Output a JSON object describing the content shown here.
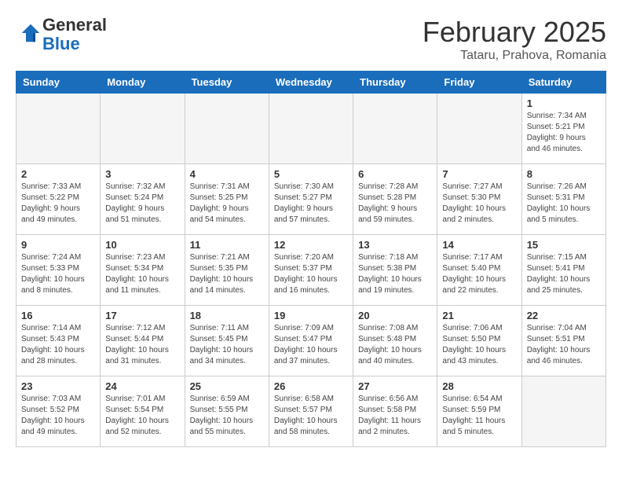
{
  "header": {
    "logo_general": "General",
    "logo_blue": "Blue",
    "month": "February 2025",
    "location": "Tataru, Prahova, Romania"
  },
  "days_of_week": [
    "Sunday",
    "Monday",
    "Tuesday",
    "Wednesday",
    "Thursday",
    "Friday",
    "Saturday"
  ],
  "weeks": [
    [
      {
        "day": "",
        "info": ""
      },
      {
        "day": "",
        "info": ""
      },
      {
        "day": "",
        "info": ""
      },
      {
        "day": "",
        "info": ""
      },
      {
        "day": "",
        "info": ""
      },
      {
        "day": "",
        "info": ""
      },
      {
        "day": "1",
        "info": "Sunrise: 7:34 AM\nSunset: 5:21 PM\nDaylight: 9 hours and 46 minutes."
      }
    ],
    [
      {
        "day": "2",
        "info": "Sunrise: 7:33 AM\nSunset: 5:22 PM\nDaylight: 9 hours and 49 minutes."
      },
      {
        "day": "3",
        "info": "Sunrise: 7:32 AM\nSunset: 5:24 PM\nDaylight: 9 hours and 51 minutes."
      },
      {
        "day": "4",
        "info": "Sunrise: 7:31 AM\nSunset: 5:25 PM\nDaylight: 9 hours and 54 minutes."
      },
      {
        "day": "5",
        "info": "Sunrise: 7:30 AM\nSunset: 5:27 PM\nDaylight: 9 hours and 57 minutes."
      },
      {
        "day": "6",
        "info": "Sunrise: 7:28 AM\nSunset: 5:28 PM\nDaylight: 9 hours and 59 minutes."
      },
      {
        "day": "7",
        "info": "Sunrise: 7:27 AM\nSunset: 5:30 PM\nDaylight: 10 hours and 2 minutes."
      },
      {
        "day": "8",
        "info": "Sunrise: 7:26 AM\nSunset: 5:31 PM\nDaylight: 10 hours and 5 minutes."
      }
    ],
    [
      {
        "day": "9",
        "info": "Sunrise: 7:24 AM\nSunset: 5:33 PM\nDaylight: 10 hours and 8 minutes."
      },
      {
        "day": "10",
        "info": "Sunrise: 7:23 AM\nSunset: 5:34 PM\nDaylight: 10 hours and 11 minutes."
      },
      {
        "day": "11",
        "info": "Sunrise: 7:21 AM\nSunset: 5:35 PM\nDaylight: 10 hours and 14 minutes."
      },
      {
        "day": "12",
        "info": "Sunrise: 7:20 AM\nSunset: 5:37 PM\nDaylight: 10 hours and 16 minutes."
      },
      {
        "day": "13",
        "info": "Sunrise: 7:18 AM\nSunset: 5:38 PM\nDaylight: 10 hours and 19 minutes."
      },
      {
        "day": "14",
        "info": "Sunrise: 7:17 AM\nSunset: 5:40 PM\nDaylight: 10 hours and 22 minutes."
      },
      {
        "day": "15",
        "info": "Sunrise: 7:15 AM\nSunset: 5:41 PM\nDaylight: 10 hours and 25 minutes."
      }
    ],
    [
      {
        "day": "16",
        "info": "Sunrise: 7:14 AM\nSunset: 5:43 PM\nDaylight: 10 hours and 28 minutes."
      },
      {
        "day": "17",
        "info": "Sunrise: 7:12 AM\nSunset: 5:44 PM\nDaylight: 10 hours and 31 minutes."
      },
      {
        "day": "18",
        "info": "Sunrise: 7:11 AM\nSunset: 5:45 PM\nDaylight: 10 hours and 34 minutes."
      },
      {
        "day": "19",
        "info": "Sunrise: 7:09 AM\nSunset: 5:47 PM\nDaylight: 10 hours and 37 minutes."
      },
      {
        "day": "20",
        "info": "Sunrise: 7:08 AM\nSunset: 5:48 PM\nDaylight: 10 hours and 40 minutes."
      },
      {
        "day": "21",
        "info": "Sunrise: 7:06 AM\nSunset: 5:50 PM\nDaylight: 10 hours and 43 minutes."
      },
      {
        "day": "22",
        "info": "Sunrise: 7:04 AM\nSunset: 5:51 PM\nDaylight: 10 hours and 46 minutes."
      }
    ],
    [
      {
        "day": "23",
        "info": "Sunrise: 7:03 AM\nSunset: 5:52 PM\nDaylight: 10 hours and 49 minutes."
      },
      {
        "day": "24",
        "info": "Sunrise: 7:01 AM\nSunset: 5:54 PM\nDaylight: 10 hours and 52 minutes."
      },
      {
        "day": "25",
        "info": "Sunrise: 6:59 AM\nSunset: 5:55 PM\nDaylight: 10 hours and 55 minutes."
      },
      {
        "day": "26",
        "info": "Sunrise: 6:58 AM\nSunset: 5:57 PM\nDaylight: 10 hours and 58 minutes."
      },
      {
        "day": "27",
        "info": "Sunrise: 6:56 AM\nSunset: 5:58 PM\nDaylight: 11 hours and 2 minutes."
      },
      {
        "day": "28",
        "info": "Sunrise: 6:54 AM\nSunset: 5:59 PM\nDaylight: 11 hours and 5 minutes."
      },
      {
        "day": "",
        "info": ""
      }
    ]
  ]
}
